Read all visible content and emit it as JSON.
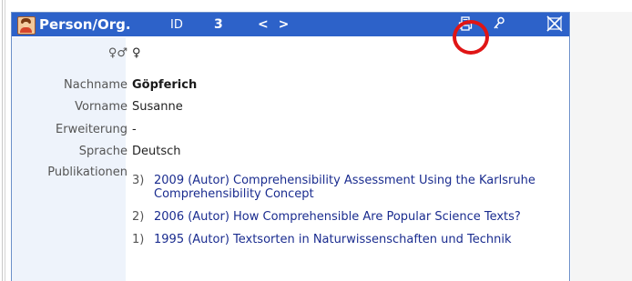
{
  "header": {
    "title": "Person/Org.",
    "id_label": "ID",
    "id_value": "3",
    "nav": "< >"
  },
  "fields": {
    "gender_label": "♀♂",
    "gender_value": "♀",
    "nachname_label": "Nachname",
    "nachname_value": "Göpferich",
    "vorname_label": "Vorname",
    "vorname_value": "Susanne",
    "erweiterung_label": "Erweiterung",
    "erweiterung_value": "-",
    "sprache_label": "Sprache",
    "sprache_value": "Deutsch",
    "publikationen_label": "Publikationen"
  },
  "publications": [
    {
      "num": "3)",
      "text": "2009 (Autor) Comprehensibility Assessment Using the Karlsruhe Comprehensibility Concept"
    },
    {
      "num": "2)",
      "text": "2006 (Autor) How Comprehensible Are Popular Science Texts?"
    },
    {
      "num": "1)",
      "text": "1995 (Autor) Textsorten in Naturwissenschaften und Technik"
    }
  ],
  "icons": {
    "avatar": "person-avatar-icon",
    "print": "print-icon",
    "key": "key-icon",
    "close": "close-icon"
  },
  "colors": {
    "titlebar": "#2d62c9",
    "label_bg": "#eef3fb",
    "link": "#1a2c8f",
    "highlight": "#e01515"
  }
}
